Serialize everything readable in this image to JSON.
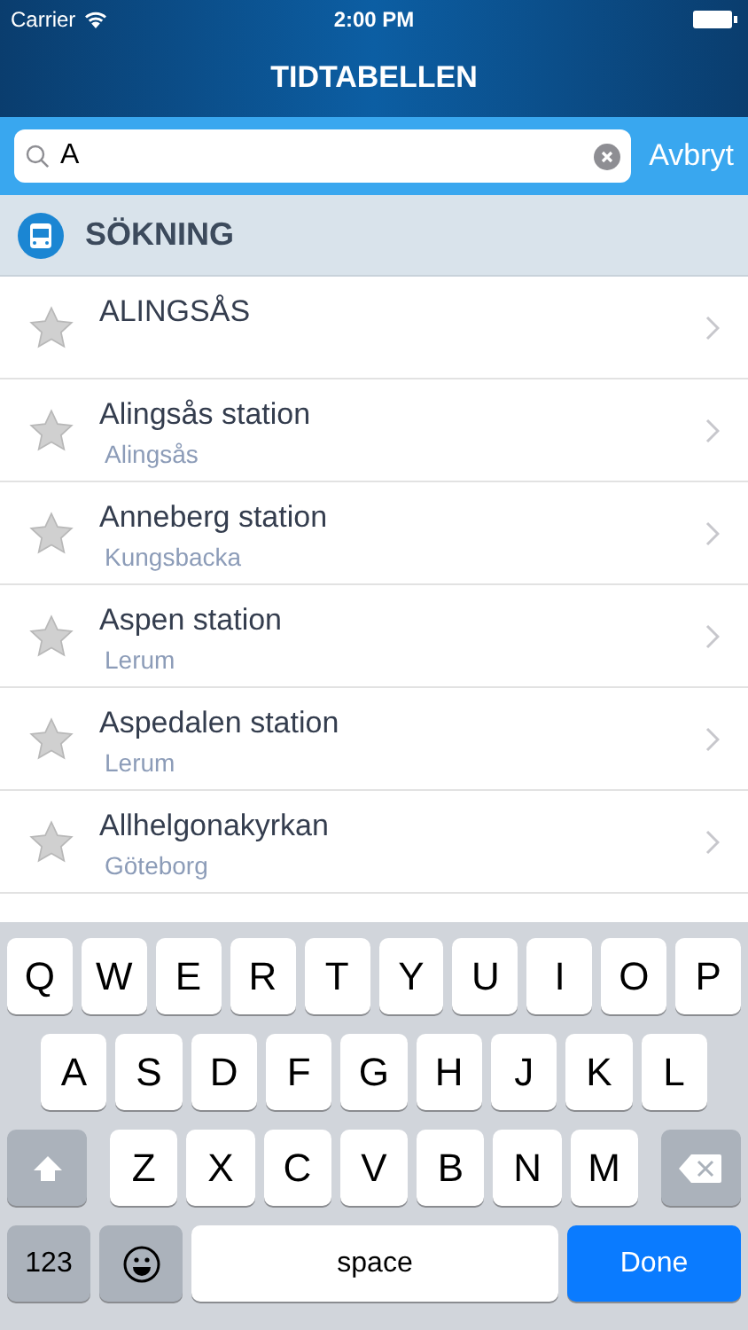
{
  "status_bar": {
    "carrier": "Carrier",
    "time": "2:00 PM"
  },
  "nav": {
    "title": "TIDTABELLEN"
  },
  "search": {
    "value": "A",
    "cancel": "Avbryt"
  },
  "section": {
    "title": "SÖKNING"
  },
  "results": [
    {
      "name": "ALINGSÅS",
      "favorite": false
    },
    {
      "name": "Alingsås station",
      "area": "Alingsås",
      "favorite": false
    },
    {
      "name": "Anneberg station",
      "area": "Kungsbacka",
      "favorite": false
    },
    {
      "name": "Aspen station",
      "area": "Lerum",
      "favorite": false
    },
    {
      "name": "Aspedalen station",
      "area": "Lerum",
      "favorite": false
    },
    {
      "name": "Allhelgonakyrkan",
      "area": "Göteborg",
      "favorite": false
    }
  ],
  "keyboard": {
    "letter_rows": [
      [
        "Q",
        "W",
        "E",
        "R",
        "T",
        "Y",
        "U",
        "I",
        "O",
        "P"
      ],
      [
        "A",
        "S",
        "D",
        "F",
        "G",
        "H",
        "J",
        "K",
        "L"
      ],
      [
        "Z",
        "X",
        "C",
        "V",
        "B",
        "N",
        "M"
      ]
    ],
    "numbers_key": "123",
    "space_key": "space",
    "done_key": "Done"
  }
}
